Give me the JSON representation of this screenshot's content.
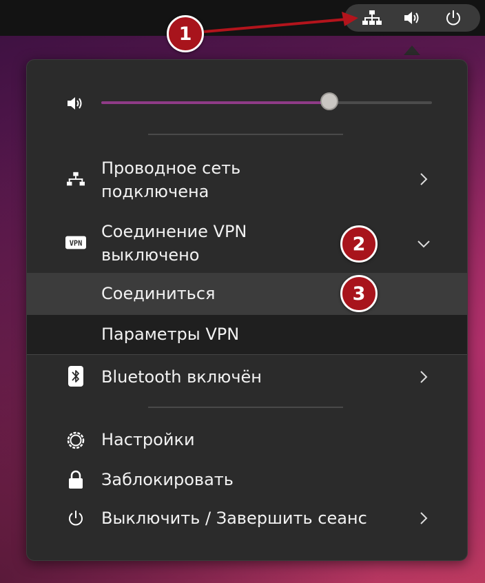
{
  "topbar": {
    "tray_icons": [
      "network-wired-icon",
      "volume-icon",
      "power-icon"
    ]
  },
  "menu": {
    "volume": {
      "level": 0.69,
      "icon": "volume-icon"
    },
    "items": [
      {
        "label_line1": "Проводное сеть",
        "label_line2": "подключена",
        "icon": "network-wired-icon",
        "chevron": "right"
      },
      {
        "label_line1": "Соединение VPN",
        "label_line2": "выключено",
        "icon": "vpn-icon",
        "icon_text": "VPN",
        "chevron": "down"
      },
      {
        "label": "Соединиться"
      },
      {
        "label": "Параметры VPN"
      },
      {
        "label": "Bluetooth включён",
        "icon": "bluetooth-icon",
        "chevron": "right"
      },
      {
        "label": "Настройки",
        "icon": "settings-gear-icon"
      },
      {
        "label": "Заблокировать",
        "icon": "lock-icon"
      },
      {
        "label": "Выключить / Завершить сеанс",
        "icon": "power-icon",
        "chevron": "right"
      }
    ]
  },
  "annotations": {
    "badge1": "1",
    "badge2": "2",
    "badge3": "3",
    "color": "#a8141c"
  }
}
